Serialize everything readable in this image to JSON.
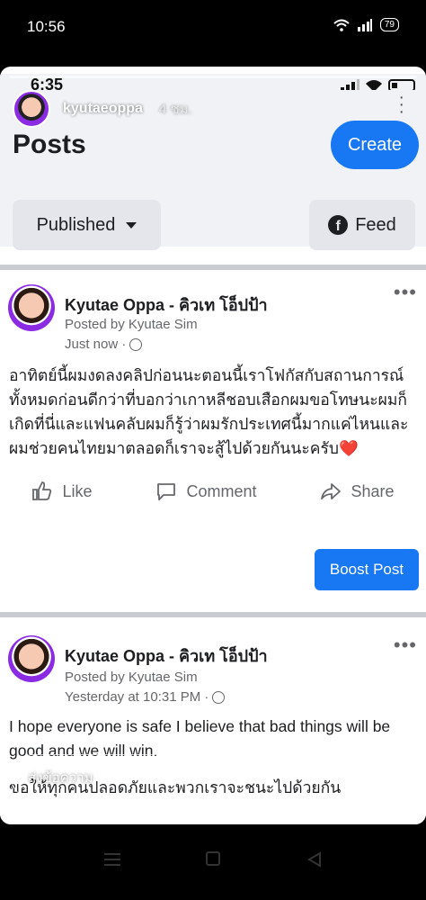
{
  "outer_status": {
    "time": "10:56",
    "battery": "79"
  },
  "story": {
    "username": "kyutaeoppa",
    "time_ago": "4 ชม.",
    "reply_placeholder": "ส่งข้อความ"
  },
  "inner_status": {
    "time": "6:35"
  },
  "header": {
    "title": "Posts",
    "create_label": "Create",
    "published_label": "Published",
    "feed_label": "Feed"
  },
  "posts": [
    {
      "page_name": "Kyutae Oppa - คิวเท โอ็ปป้า",
      "posted_by": "Posted by Kyutae Sim",
      "time": "Just now ·",
      "text": "อาทิตย์นี้ผมงดลงคลิปก่อนนะตอนนี้เราโฟกัสกับสถานการณ์ทั้งหมดก่อนดีกว่าที่บอกว่าเกาหลีชอบเสือกผมขอโทษนะผมก็เกิดที่นี่และแฟนคลับผมก็รู้ว่าผมรักประเทศนี้มากแค่ไหนและผมช่วยคนไทยมาตลอดก็เราจะสู้ไปด้วยกันนะครับ❤️",
      "like": "Like",
      "comment": "Comment",
      "share": "Share",
      "boost": "Boost Post"
    },
    {
      "page_name": "Kyutae Oppa - คิวเท โอ็ปป้า",
      "posted_by": "Posted by Kyutae Sim",
      "time": "Yesterday at 10:31 PM ·",
      "text": "I hope everyone is safe I believe that bad things will be good and we will win.",
      "text_th": "ขอให้ทุกคนปลอดภัยและพวกเราจะชนะไปด้วยกัน"
    }
  ]
}
